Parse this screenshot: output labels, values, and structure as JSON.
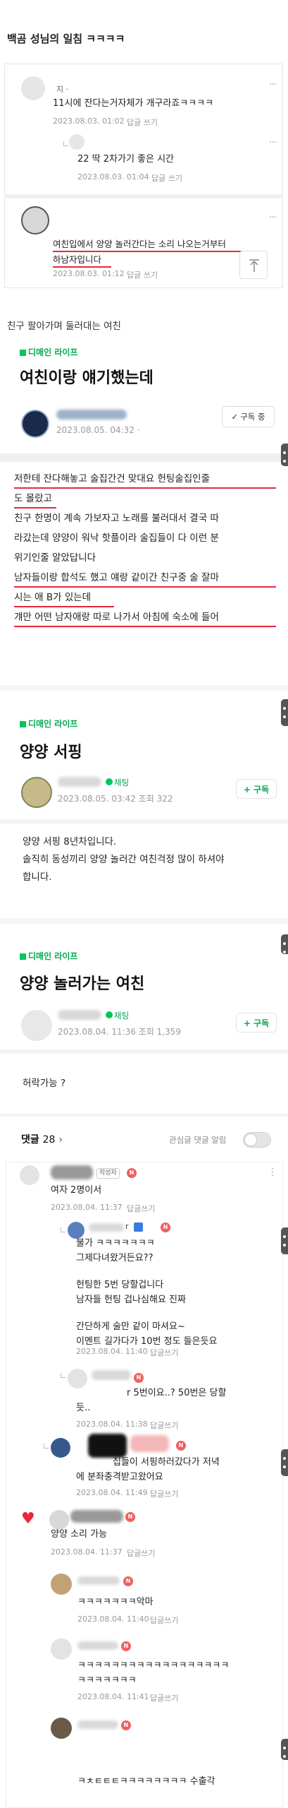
{
  "page_title": "백곰 성님의 일침 ㅋㅋㅋㅋ",
  "top_comments": {
    "c1": {
      "text": "11시에 잔다는거자체가 개구라죠ㅋㅋㅋㅋ",
      "date": "2023.08.03. 01:02",
      "reply": "답글 쓰기",
      "name": "지 ·"
    },
    "c2": {
      "text": "22 딱 2차가기 좋은 시간",
      "date": "2023.08.03. 01:04",
      "reply": "답글 쓰기"
    },
    "c3": {
      "text_line1": "여친입에서 양양 놀러간다는 소리 나오는거부터",
      "text_line2": "하남자입니다",
      "date": "2023.08.03. 01:12",
      "reply": "답글 쓰기"
    }
  },
  "caption2": "친구 팔아가며 둘러대는 여친",
  "post1": {
    "cafe": "디매인 라이프",
    "title": "여친이랑 얘기했는데",
    "meta": "2023.08.05. 04:32 ·",
    "subscribe": "구독 중",
    "body": [
      "저한테 잔다해놓고 술집간건 맞대요 헌팅술집인줄",
      "도 몰랐고",
      "친구 한명이 계속 가보자고 노래를 불러대서 결국 따",
      "라갔는데 양양이 워낙 핫플이라 술집들이 다 이런 분",
      "위기인줄 알았답니다",
      "남자들이랑 합석도 했고 얘랑 같이간 친구중 술 잘마",
      "시는 애 B가 있는데",
      "걔만 어떤 남자애랑 따로 나가서 아침에 숙소에 들어"
    ]
  },
  "post2": {
    "cafe": "디매인 라이프",
    "title": "양양 서핑",
    "chat": "채팅",
    "meta": "2023.08.05. 03:42 조회 322",
    "follow": "+ 구독",
    "body": [
      "양양 서핑 8년차입니다.",
      "솔직히 동성끼리 양양 놀러간 여친걱정 많이 하셔야",
      "합니다."
    ]
  },
  "post3": {
    "cafe": "디매인 라이프",
    "title": "양양 놀러가는 여친",
    "chat": "채팅",
    "meta": "2023.08.04. 11:36 조회 1,359",
    "follow": "+ 구독",
    "body": "허락가능 ?"
  },
  "comments_header": {
    "label": "댓글",
    "count": "28",
    "alert": "관심글 댓글 알림"
  },
  "comments": [
    {
      "tag": "작성자",
      "text": "여자 2명이서",
      "date": "2023.08.04. 11:37",
      "reply": "답글쓰기"
    },
    {
      "name": "r",
      "lines": [
        "불가 ㅋㅋㅋㅋㅋㅋㅋ",
        "그제다녀왔거든요??",
        "",
        "헌팅한 5번 당할겁니다",
        "남자들 헌팅 겁나심해요 진짜",
        "",
        "간단하게 술만 같이 마셔요~",
        "이멘트 길가다가 10번 정도 들은듯요"
      ],
      "date": "2023.08.04. 11:40",
      "reply": "답글쓰기"
    },
    {
      "lines": [
        "r 5번이요..? 50번은 당할",
        "듯.."
      ],
      "date": "2023.08.04. 11:38",
      "reply": "답글쓰기"
    },
    {
      "lines": [
        "집들이 서핑하러갔다가 저녁",
        "에 분좌충격받고왔어요"
      ],
      "date": "2023.08.04. 11:49",
      "reply": "답글쓰기"
    },
    {
      "text": "양양 소리 가능",
      "date": "2023.08.04. 11:37",
      "reply": "답글쓰기"
    },
    {
      "text": "ㅋㅋㅋㅋㅋㅋㅋ악마",
      "date": "2023.08.04. 11:40",
      "reply": "답글쓰기"
    },
    {
      "lines": [
        "ㅋㅋㅋㅋㅋㅋㅋㅋㅋㅋㅋㅋㅋㅋㅋㅋㅋㅋ",
        "ㅋㅋㅋㅋㅋㅋㅋ"
      ],
      "date": "2023.08.04. 11:41",
      "reply": "답글쓰기"
    },
    {
      "text": "ㅋㅊㅌㅌㅌㅋㅋㅋㅋㅋㅋㅋㅋ 수출각"
    }
  ]
}
